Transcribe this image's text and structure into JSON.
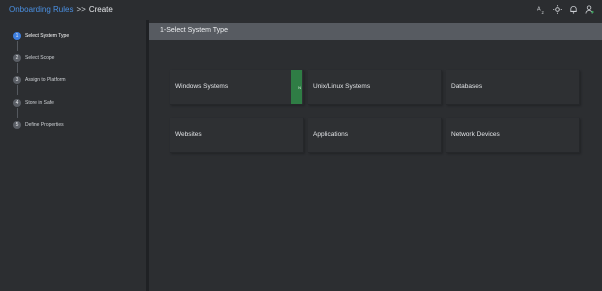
{
  "header": {
    "breadcrumb": {
      "link": "Onboarding Rules",
      "separator": ">>",
      "current": "Create"
    },
    "icons": [
      "translate-icon",
      "theme-icon",
      "notification-icon",
      "user-icon"
    ]
  },
  "sidebar": {
    "steps": [
      {
        "number": "1",
        "label": "Select System Type",
        "active": true
      },
      {
        "number": "2",
        "label": "Select Scope",
        "active": false
      },
      {
        "number": "3",
        "label": "Assign to Platform",
        "active": false
      },
      {
        "number": "4",
        "label": "Store in Safe",
        "active": false
      },
      {
        "number": "5",
        "label": "Define Properties",
        "active": false
      }
    ]
  },
  "main": {
    "title": "1-Select System Type",
    "cards": [
      {
        "label": "Windows Systems",
        "tag": "N"
      },
      {
        "label": "Unix/Linux Systems"
      },
      {
        "label": "Databases"
      },
      {
        "label": "Websites"
      },
      {
        "label": "Applications"
      },
      {
        "label": "Network Devices"
      }
    ]
  },
  "colors": {
    "accent": "#3d7ee0",
    "link": "#4a90e2",
    "tag": "#2f7d45"
  }
}
